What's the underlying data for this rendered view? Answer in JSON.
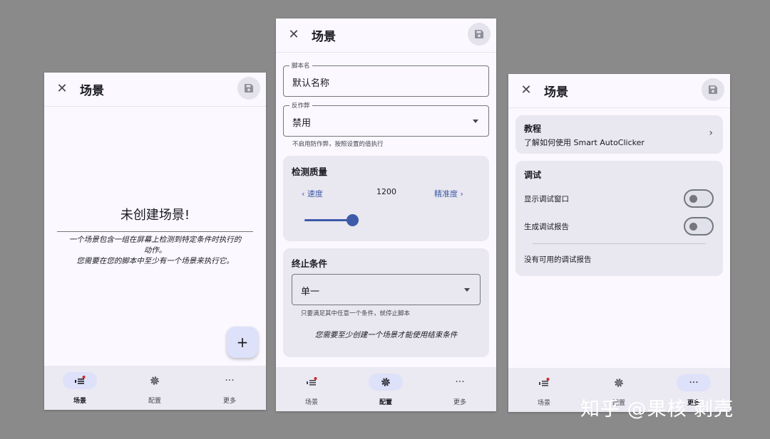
{
  "common": {
    "screen_title": "场景",
    "nav": {
      "scenarios": "场景",
      "config": "配置",
      "more": "更多"
    }
  },
  "screen1": {
    "empty_title": "未创建场景!",
    "empty_desc_line1": "一个场景包含一组在屏幕上检测到特定条件时执行的",
    "empty_desc_line2": "动作。",
    "empty_desc_line3": "您需要在您的脚本中至少有一个场景来执行它。",
    "fab_label": "+"
  },
  "screen2": {
    "script_name_label": "脚本名",
    "script_name_value": "默认名称",
    "anti_cheat_label": "反作弊",
    "anti_cheat_value": "禁用",
    "anti_cheat_hint": "不启用防作弊，按照设置的值执行",
    "detection_quality_title": "检测质量",
    "speed_label": "速度",
    "precision_label": "精准度",
    "quality_value": "1200",
    "quality_level": 0.32,
    "end_condition_title": "终止条件",
    "end_condition_value": "单一",
    "end_condition_hint": "只要满足其中任意一个条件，就停止脚本",
    "end_condition_note": "您需要至少创建一个场景才能使用结束条件"
  },
  "screen3": {
    "tutorial_title": "教程",
    "tutorial_sub": "了解如何使用 Smart AutoClicker",
    "debug_title": "调试",
    "show_debug_window": "显示调试窗口",
    "generate_debug_report": "生成调试报告",
    "no_report": "没有可用的调试报告",
    "show_debug_window_on": false,
    "generate_debug_report_on": false
  },
  "watermark": "知乎 @果核 剥壳",
  "colors": {
    "accent": "#3d5ba9",
    "active_pill": "#dde1f9",
    "card": "#e9e7ef",
    "background": "#8a8a8a"
  }
}
